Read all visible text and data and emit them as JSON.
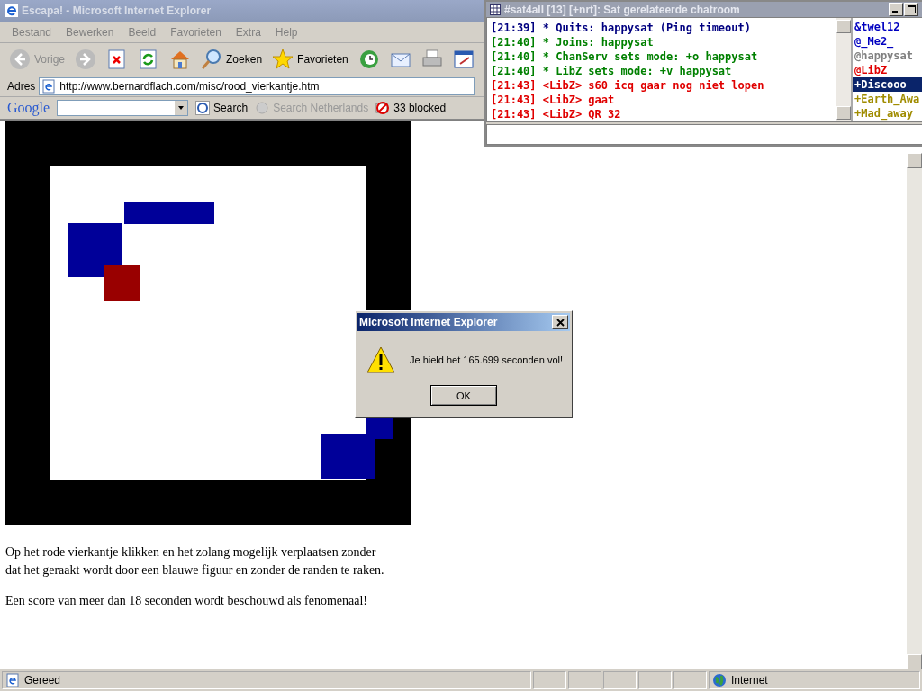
{
  "window": {
    "title": "Escapa! - Microsoft Internet Explorer"
  },
  "menu": [
    "Bestand",
    "Bewerken",
    "Beeld",
    "Favorieten",
    "Extra",
    "Help"
  ],
  "toolbar": [
    {
      "kind": "back",
      "label": "Vorige",
      "disabled": true
    },
    {
      "kind": "forward",
      "disabled": true
    },
    {
      "kind": "stop"
    },
    {
      "kind": "refresh"
    },
    {
      "kind": "home"
    },
    {
      "kind": "search",
      "label": "Zoeken"
    },
    {
      "kind": "favorites",
      "label": "Favorieten"
    },
    {
      "kind": "history"
    },
    {
      "kind": "mail"
    },
    {
      "kind": "print"
    },
    {
      "kind": "edit"
    }
  ],
  "address": {
    "label": "Adres",
    "url": "http://www.bernardflach.com/misc/rood_vierkantje.htm"
  },
  "google_bar": {
    "logo": "Google",
    "search": "Search",
    "search_site": "Search Netherlands",
    "blocked": "33 blocked"
  },
  "page": {
    "paragraphs": [
      [
        "Op het rode vierkantje klikken en het zolang mogelijk verplaatsen zonder",
        "dat het geraakt wordt door een blauwe figuur en zonder de randen te raken."
      ],
      [
        "Een score van meer dan 18 seconden wordt beschouwd als fenomenaal!"
      ]
    ]
  },
  "dialog": {
    "title": "Microsoft Internet Explorer",
    "message": "Je hield het 165.699 seconden vol!",
    "button": "OK"
  },
  "status_bar": {
    "text": "Gereed",
    "zone": "Internet"
  },
  "chat": {
    "title": "#sat4all [13] [+nrt]: Sat gerelateerde chatroom",
    "lines": [
      {
        "time": "[21:39]",
        "text": "* Quits: happysat (Ping timeout)",
        "color": "#000080"
      },
      {
        "time": "[21:40]",
        "text": "* Joins: happysat",
        "color": "#008000"
      },
      {
        "time": "[21:40]",
        "text": "* ChanServ sets mode: +o happysat",
        "color": "#008000"
      },
      {
        "time": "[21:40]",
        "text": "* LibZ sets mode: +v happysat",
        "color": "#008000"
      },
      {
        "time": "[21:43]",
        "text": "<LibZ> s60 icq gaar nog niet lopen",
        "color": "#e00000"
      },
      {
        "time": "[21:43]",
        "text": "<LibZ> gaat",
        "color": "#e00000"
      },
      {
        "time": "[21:43]",
        "text": "<LibZ> QR 32",
        "color": "#e00000"
      }
    ],
    "nicks": [
      {
        "name": "&twel12",
        "color": "#0000c0",
        "selected": false
      },
      {
        "name": "@_Me2_",
        "color": "#0000c0",
        "selected": false
      },
      {
        "name": "@happysat",
        "color": "#808080",
        "selected": false
      },
      {
        "name": "@LibZ",
        "color": "#e00000",
        "selected": false
      },
      {
        "name": "+Discooo",
        "selected": true
      },
      {
        "name": "+Earth_Awa",
        "color": "#a08c00",
        "selected": false
      },
      {
        "name": "+Mad_away",
        "color": "#a08c00",
        "selected": false
      }
    ]
  }
}
